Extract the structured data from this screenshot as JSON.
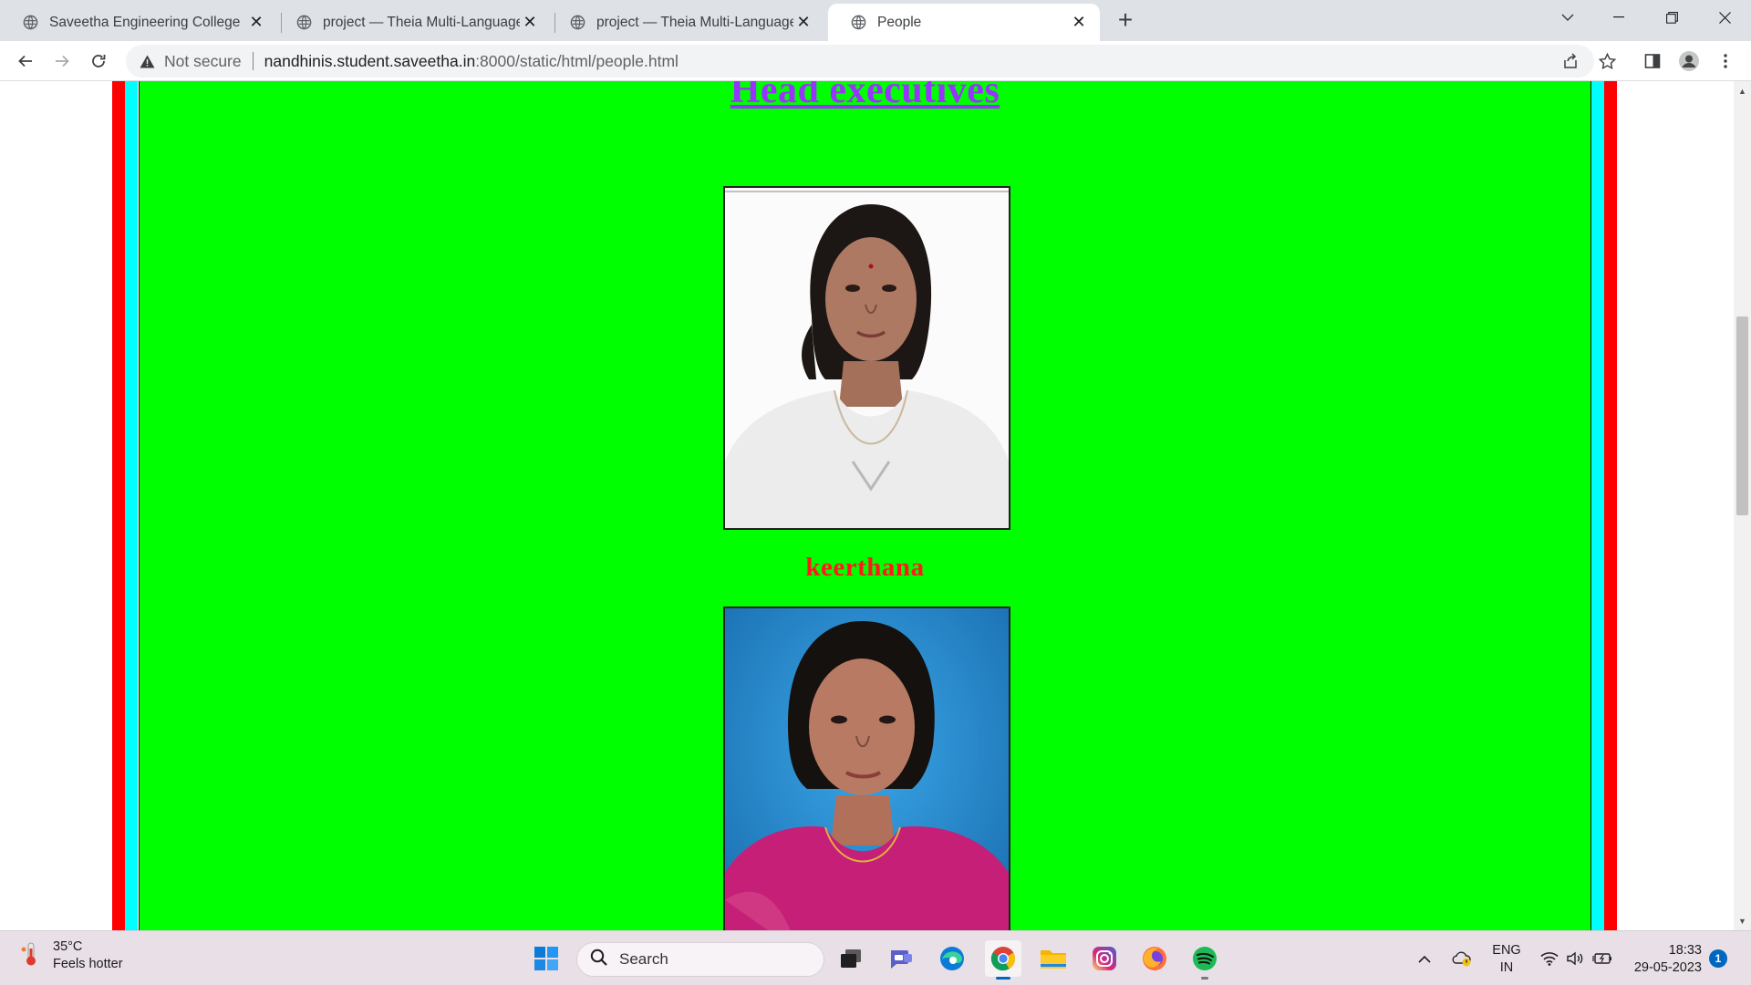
{
  "browser": {
    "tabs": [
      {
        "title": "Saveetha Engineering College",
        "active": false
      },
      {
        "title": "project — Theia Multi-Language",
        "active": false
      },
      {
        "title": "project — Theia Multi-Language",
        "active": false
      },
      {
        "title": "People",
        "active": true
      }
    ],
    "security_label": "Not secure",
    "url_host": "nandhinis.student.saveetha.in",
    "url_path": ":8000/static/html/people.html"
  },
  "page": {
    "heading": "Head executives",
    "people": [
      {
        "name": "keerthana",
        "photo_bg": "#fafafa"
      },
      {
        "name": "",
        "photo_bg": "#1e90d6"
      }
    ],
    "colors": {
      "outer_border": "#ff0000",
      "inner_border": "#00ffff",
      "panel": "#00ff00",
      "heading": "#9933ff",
      "name": "#ff1a1a"
    }
  },
  "taskbar": {
    "weather_temp": "35°C",
    "weather_desc": "Feels hotter",
    "search_label": "Search",
    "lang_line1": "ENG",
    "lang_line2": "IN",
    "time": "18:33",
    "date": "29-05-2023",
    "notification_count": "1",
    "apps": [
      "start-icon",
      "search-icon",
      "task-view-icon",
      "teams-chat-icon",
      "edge-icon",
      "chrome-icon",
      "file-explorer-icon",
      "instagram-icon",
      "firefox-icon",
      "spotify-icon"
    ]
  }
}
